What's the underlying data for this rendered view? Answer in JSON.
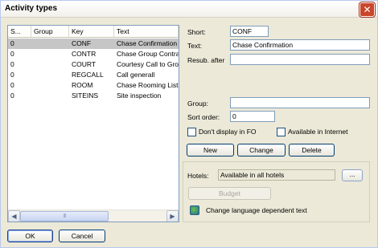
{
  "window": {
    "title": "Activity types",
    "close_glyph": "✕"
  },
  "list": {
    "columns": [
      "S...",
      "Group",
      "Key",
      "Text"
    ],
    "rows": [
      {
        "s": "0",
        "group": "",
        "key": "CONF",
        "text": "Chase Confirmation"
      },
      {
        "s": "0",
        "group": "",
        "key": "CONTR",
        "text": "Chase Group Contra"
      },
      {
        "s": "0",
        "group": "",
        "key": "COURT",
        "text": "Courtesy Call to Gro"
      },
      {
        "s": "0",
        "group": "",
        "key": "REGCALL",
        "text": "Call generall"
      },
      {
        "s": "0",
        "group": "",
        "key": "ROOM",
        "text": "Chase Rooming List"
      },
      {
        "s": "0",
        "group": "",
        "key": "SITEINS",
        "text": "Site inspection"
      }
    ],
    "scroll_left_glyph": "◀",
    "scroll_right_glyph": "▶",
    "thumb_grip": "III"
  },
  "form": {
    "short_label": "Short:",
    "short_value": "CONF",
    "text_label": "Text:",
    "text_value": "Chase Confirmation",
    "resub_label": "Resub. after",
    "resub_value": "",
    "group_label": "Group:",
    "group_value": "",
    "sort_label": "Sort order:",
    "sort_value": "0",
    "dont_display_label": "Don't display in FO",
    "available_internet_label": "Available in Internet"
  },
  "actions": {
    "new": "New",
    "change": "Change",
    "delete": "Delete"
  },
  "hotels": {
    "label": "Hotels:",
    "value": "Available in all hotels",
    "browse": "...",
    "budget": "Budget",
    "language_text": "Change language dependent text"
  },
  "footer": {
    "ok": "OK",
    "cancel": "Cancel"
  },
  "colors": {
    "title_close": "#c9462a",
    "selected_row": "#c6c6c6",
    "field_border": "#7f9db9"
  }
}
